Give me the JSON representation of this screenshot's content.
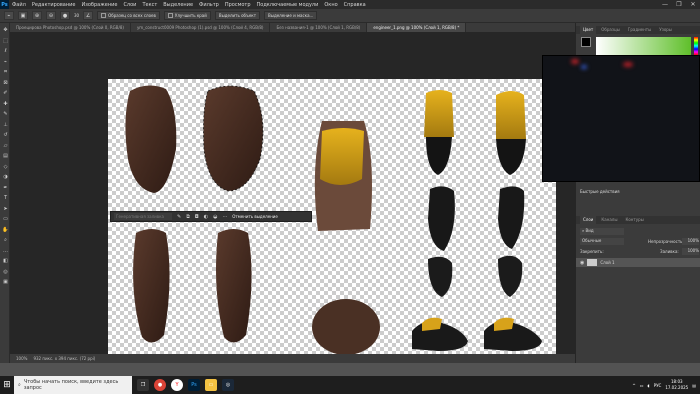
{
  "menubar": {
    "logo": "Ps",
    "items": [
      "Файл",
      "Редактирование",
      "Изображение",
      "Слои",
      "Текст",
      "Выделение",
      "Фильтр",
      "Просмотр",
      "Подключаемые модули",
      "Окно",
      "Справка"
    ],
    "window_controls": [
      "—",
      "❐",
      "✕"
    ]
  },
  "options": {
    "brush_size": "30",
    "sample_all_layers": "Образец со всех слоев",
    "enhance_edge": "Улучшить край",
    "select_subject": "Выделить объект",
    "select_and_mask": "Выделение и маска..."
  },
  "tabs": [
    {
      "label": "Проецирова Photoshop.psd @ 100% (Слой 0, RGB/8)",
      "active": false
    },
    {
      "label": "ym_construct0009 Photoshop (1).psd @ 100% (Слой 4, RGB/8)",
      "active": false
    },
    {
      "label": "Без названия-1 @ 100% (Слой 1, RGB/8)",
      "active": false
    },
    {
      "label": "engineer_1.png @ 100% (Слой 1, RGB/8) *",
      "active": true
    }
  ],
  "toolbar": {
    "icons": [
      "move-icon",
      "marquee-icon",
      "lasso-icon",
      "quick-select-icon",
      "crop-icon",
      "frame-icon",
      "eyedropper-icon",
      "healing-icon",
      "brush-icon",
      "stamp-icon",
      "history-brush-icon",
      "eraser-icon",
      "gradient-icon",
      "blur-icon",
      "dodge-icon",
      "pen-icon",
      "type-icon",
      "path-select-icon",
      "shape-icon",
      "hand-icon",
      "zoom-icon",
      "more-icon",
      "colors-icon",
      "quickmask-icon",
      "screenmode-icon"
    ]
  },
  "context_bar": {
    "placeholder": "Генеративная заливка",
    "cancel_selection": "Отменить выделение",
    "more": "···"
  },
  "status": {
    "zoom": "100%",
    "doc_info": "932 пикс. x 394 пикс. (72 ppi)"
  },
  "right_panel": {
    "color_tabs": [
      "Цвет",
      "Образцы",
      "Градиенты",
      "Узоры"
    ],
    "actions_title": "Быстрые действия",
    "layer_tabs": [
      "Слои",
      "Каналы",
      "Контуры"
    ],
    "kind_label": "Вид",
    "blend_mode": "Обычные",
    "opacity_label": "Непрозрачность:",
    "opacity_value": "100%",
    "lock_label": "Закрепить:",
    "fill_label": "Заливка:",
    "fill_value": "100%",
    "layer_name": "Слой 1"
  },
  "taskbar": {
    "search_placeholder": "Чтобы начать поиск, введите здесь запрос",
    "apps": [
      "task-view-icon",
      "chrome-icon",
      "yandex-icon",
      "photoshop-icon",
      "explorer-icon",
      "steam-icon"
    ],
    "language": "РУС",
    "time": "18:03",
    "date": "17.02.2025"
  },
  "colors": {
    "canvas_bg": "#262626",
    "panel_bg": "#3b3b3b",
    "accent": "#31a8ff"
  }
}
